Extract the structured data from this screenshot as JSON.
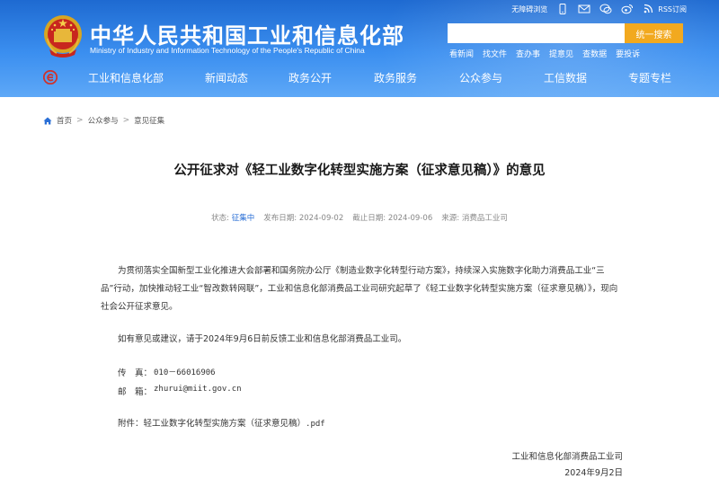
{
  "header": {
    "site_title": "中华人民共和国工业和信息化部",
    "site_subtitle": "Ministry of Industry and Information Technology of the People's Republic of China",
    "top_links": {
      "accessibility": "无障碍浏览",
      "rss": "RSS订阅"
    },
    "search": {
      "placeholder": "",
      "button_label": "统一搜索"
    },
    "quick_links": [
      "看新闻",
      "找文件",
      "查办事",
      "提意见",
      "查数据",
      "要投诉"
    ],
    "nav": [
      "工业和信息化部",
      "新闻动态",
      "政务公开",
      "政务服务",
      "公众参与",
      "工信数据",
      "专题专栏"
    ],
    "colors": {
      "header_blue": "#2f7fe6",
      "search_button": "#f2a91f",
      "nav_icon_red": "#d0322a"
    }
  },
  "breadcrumb": {
    "items": [
      "首页",
      "公众参与",
      "意见征集"
    ],
    "separator": ">"
  },
  "article": {
    "title": "公开征求对《轻工业数字化转型实施方案（征求意见稿）》的意见",
    "meta": {
      "status_label": "状态:",
      "status_value": "征集中",
      "publish_label": "发布日期:",
      "publish_value": "2024-09-02",
      "deadline_label": "截止日期:",
      "deadline_value": "2024-09-06",
      "source_label": "来源:",
      "source_value": "消费品工业司"
    },
    "paragraph_1": "为贯彻落实全国新型工业化推进大会部署和国务院办公厅《制造业数字化转型行动方案》，持续深入实施数字化助力消费品工业“三品”行动，加快推动轻工业“智改数转网联”，工业和信息化部消费品工业司研究起草了《轻工业数字化转型实施方案（征求意见稿）》，现向社会公开征求意见。",
    "paragraph_2": "如有意见或建议，请于2024年9月6日前反馈工业和信息化部消费品工业司。",
    "fax_label": "传　真：",
    "fax_value": "010－66016906",
    "email_label": "邮　箱：",
    "email_value": "zhurui@miit.gov.cn",
    "attachment_label": "附件：",
    "attachment_name": "轻工业数字化转型实施方案（征求意见稿）",
    "attachment_ext": ".pdf",
    "sign_org": "工业和信息化部消费品工业司",
    "sign_date": "2024年9月2日"
  }
}
